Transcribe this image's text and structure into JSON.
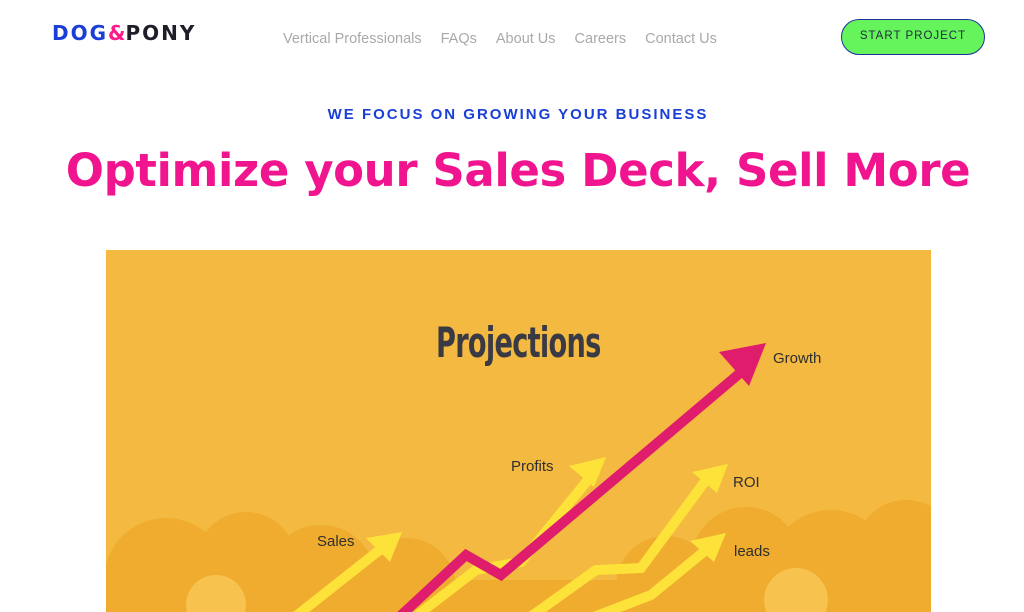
{
  "header": {
    "logo": {
      "part1": "DOG",
      "amp": "&",
      "part2": "PONY"
    },
    "nav": [
      {
        "label": "Vertical Professionals"
      },
      {
        "label": "FAQs"
      },
      {
        "label": "About Us"
      },
      {
        "label": "Careers"
      },
      {
        "label": "Contact Us"
      }
    ],
    "cta_label": "START PROJECT"
  },
  "hero": {
    "eyebrow": "WE FOCUS ON GROWING YOUR BUSINESS",
    "headline": "Optimize your Sales Deck, Sell More"
  },
  "illustration": {
    "title": "Projections",
    "labels": {
      "growth": "Growth",
      "profits": "Profits",
      "roi": "ROI",
      "sales": "Sales",
      "leads": "leads"
    }
  },
  "colors": {
    "brand_blue": "#1a3fd6",
    "brand_pink": "#f0158e",
    "cta_green": "#66f45c",
    "slide_bg": "#f4b940",
    "arrow_yellow": "#fde23a",
    "arrow_pink": "#e01c6c"
  }
}
